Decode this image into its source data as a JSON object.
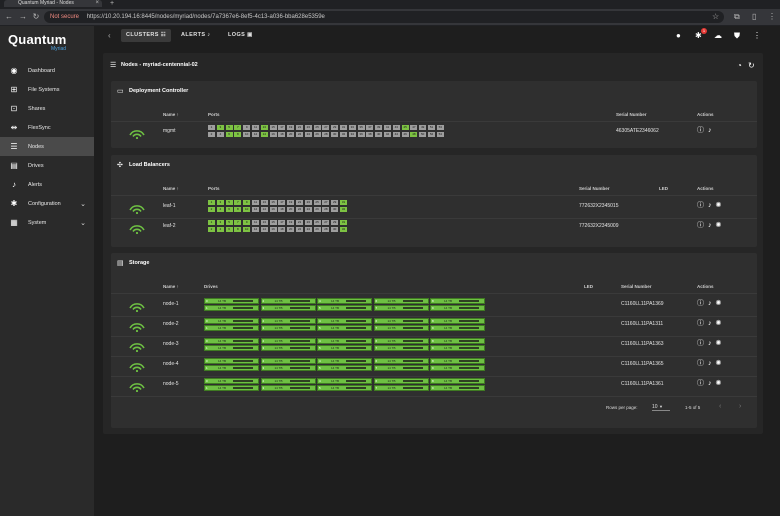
{
  "browser": {
    "tab_title": "Quantum Myriad - Nodes",
    "not_secure": "Not secure",
    "url": "https://10.20.194.16:8445/nodes/myriad/nodes/7a7367e6-8ef5-4c13-a036-bba628e5359e"
  },
  "brand": {
    "name": "Quantum",
    "product": "Myriad"
  },
  "sidebar": {
    "items": [
      {
        "label": "Dashboard",
        "icon": "dashboard-icon",
        "glyph": "◉"
      },
      {
        "label": "File Systems",
        "icon": "file-systems-icon",
        "glyph": "⊞"
      },
      {
        "label": "Shares",
        "icon": "shares-icon",
        "glyph": "⊡"
      },
      {
        "label": "FlexSync",
        "icon": "flexsync-icon",
        "glyph": "⇹"
      },
      {
        "label": "Nodes",
        "icon": "nodes-icon",
        "glyph": "☰"
      },
      {
        "label": "Drives",
        "icon": "drives-icon",
        "glyph": "▤"
      },
      {
        "label": "Alerts",
        "icon": "bell-icon",
        "glyph": "♪"
      },
      {
        "label": "Configuration",
        "icon": "gear-icon",
        "glyph": "✱"
      },
      {
        "label": "System",
        "icon": "system-icon",
        "glyph": "▦"
      }
    ],
    "active": "Nodes"
  },
  "topbar": {
    "clusters": "CLUSTERS",
    "alerts": "ALERTS",
    "logs": "LOGS",
    "alert_count": "1"
  },
  "page": {
    "title": "Nodes - myriad-centennial-02"
  },
  "deployment_controller": {
    "title": "Deployment Controller",
    "headers": {
      "name": "Name",
      "ports": "Ports",
      "serial": "Serial Number",
      "actions": "Actions"
    },
    "rows": [
      {
        "name": "mgmt",
        "serial": "46305ATE2346062"
      }
    ],
    "ports_top": [
      "1",
      "3",
      "5",
      "7",
      "9",
      "11",
      "13",
      "15",
      "17",
      "19",
      "21",
      "23",
      "25",
      "27",
      "29",
      "31",
      "33",
      "35",
      "37",
      "39",
      "41",
      "43",
      "45",
      "47",
      "49",
      "51",
      "53"
    ],
    "ports_bottom": [
      "2",
      "4",
      "6",
      "8",
      "10",
      "12",
      "14",
      "16",
      "18",
      "20",
      "22",
      "24",
      "26",
      "28",
      "30",
      "32",
      "34",
      "36",
      "38",
      "40",
      "42",
      "44",
      "46",
      "48",
      "50",
      "52",
      "54"
    ],
    "active_top": [
      1,
      2,
      3,
      6,
      22
    ],
    "active_bottom": [
      2,
      3,
      6,
      23
    ]
  },
  "load_balancers": {
    "title": "Load Balancers",
    "headers": {
      "name": "Name",
      "ports": "Ports",
      "serial": "Serial Number",
      "led": "LED",
      "actions": "Actions"
    },
    "rows": [
      {
        "name": "leaf-1",
        "serial": "772632X2345015"
      },
      {
        "name": "leaf-2",
        "serial": "772632X2345009"
      }
    ],
    "ports_top": [
      "1",
      "3",
      "5",
      "7",
      "9",
      "11",
      "13",
      "15",
      "17",
      "19",
      "21",
      "23",
      "25",
      "27",
      "29",
      "31"
    ],
    "ports_bottom": [
      "2",
      "4",
      "6",
      "8",
      "10",
      "12",
      "14",
      "16",
      "18",
      "20",
      "22",
      "24",
      "26",
      "28",
      "30",
      "32"
    ],
    "active_top": [
      0,
      1,
      2,
      3,
      4,
      15
    ],
    "active_bottom": [
      0,
      1,
      2,
      3,
      4,
      15
    ]
  },
  "storage": {
    "title": "Storage",
    "headers": {
      "name": "Name",
      "drives": "Drives",
      "led": "LED",
      "serial": "Serial Number",
      "actions": "Actions"
    },
    "drive_cap": "14 TB",
    "rows": [
      {
        "name": "node-1",
        "serial": "C1160LL11PA1369"
      },
      {
        "name": "node-2",
        "serial": "C1160LL11PA1311"
      },
      {
        "name": "node-3",
        "serial": "C1160LL11PA1363"
      },
      {
        "name": "node-4",
        "serial": "C1160LL11PA1365"
      },
      {
        "name": "node-5",
        "serial": "C1160LL11PA1361"
      }
    ],
    "drive_labels_top": [
      "0",
      "2",
      "4",
      "6",
      "8"
    ],
    "drive_labels_bottom": [
      "1",
      "3",
      "5",
      "7",
      "9"
    ]
  },
  "pagination": {
    "rows_per_page_label": "Rows per page:",
    "rows_per_page": "10",
    "range": "1-5 of 5"
  },
  "colors": {
    "active_port": "#7dc243",
    "inactive_port": "#9e9e9e",
    "status_green": "#6ec043",
    "drive_green": "#6ec043"
  }
}
